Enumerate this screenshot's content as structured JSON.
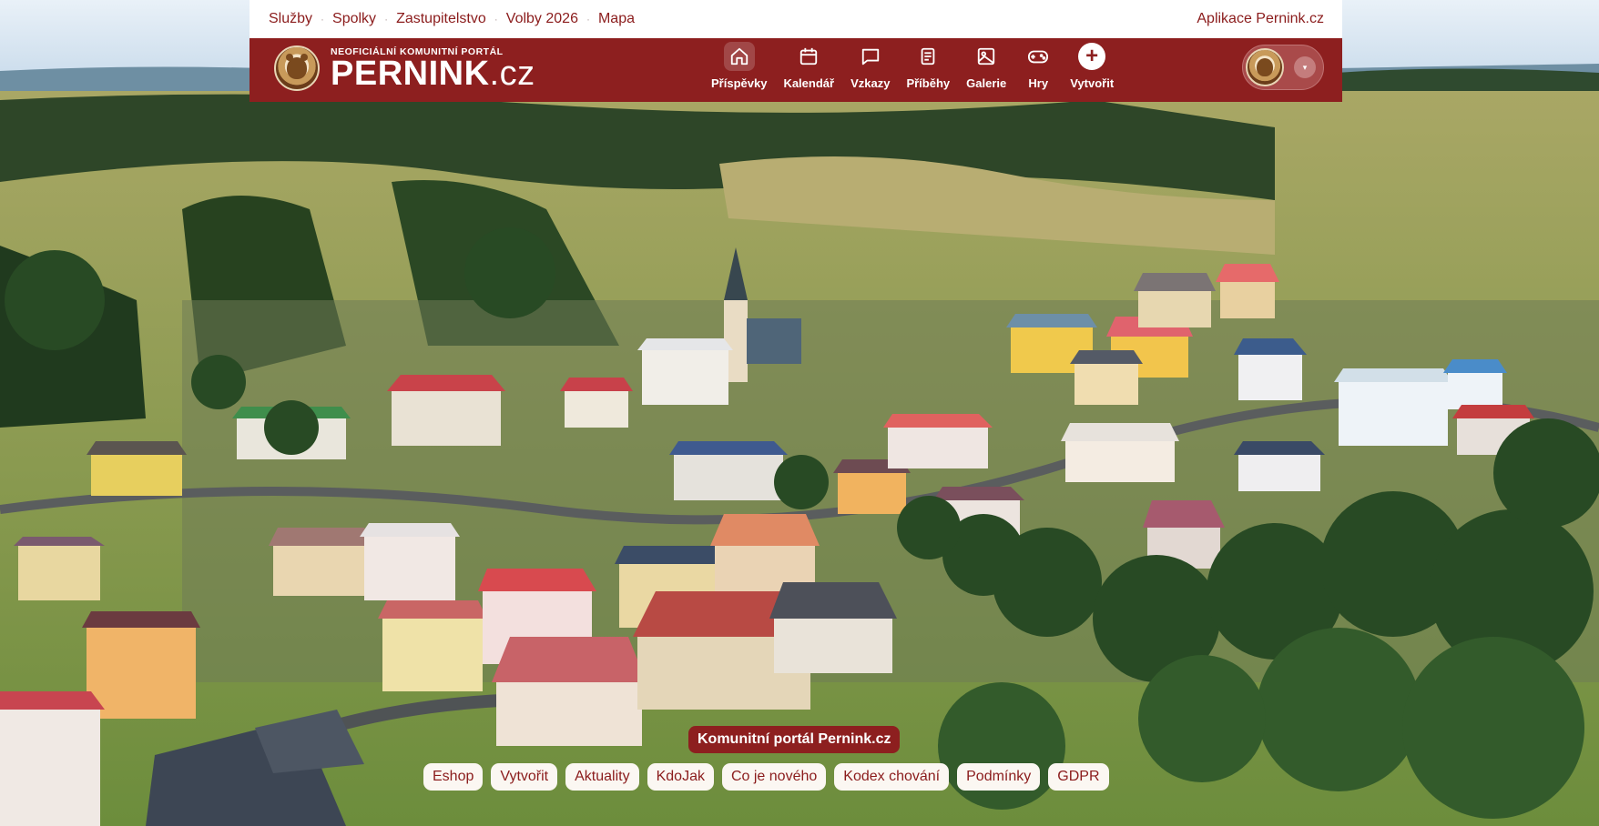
{
  "top_links": {
    "items": [
      "Služby",
      "Spolky",
      "Zastupitelstvo",
      "Volby 2026",
      "Mapa"
    ],
    "separator": "·",
    "app_link": "Aplikace Pernink.cz"
  },
  "header": {
    "logo": {
      "tagline": "NEOFICIÁLNÍ KOMUNITNÍ PORTÁL",
      "name": "PERNINK",
      "tld": ".cz"
    },
    "nav": [
      {
        "label": "Příspěvky",
        "icon": "home-icon",
        "active": true
      },
      {
        "label": "Kalendář",
        "icon": "calendar-icon"
      },
      {
        "label": "Vzkazy",
        "icon": "message-icon"
      },
      {
        "label": "Příběhy",
        "icon": "document-icon"
      },
      {
        "label": "Galerie",
        "icon": "image-icon"
      },
      {
        "label": "Hry",
        "icon": "gamepad-icon"
      },
      {
        "label": "Vytvořit",
        "icon": "plus-icon"
      }
    ],
    "user_caret": "▾"
  },
  "footer": {
    "portal_badge": "Komunitní portál Pernink.cz",
    "links": [
      "Eshop",
      "Vytvořit",
      "Aktuality",
      "KdoJak",
      "Co je nového",
      "Kodex chování",
      "Podmínky",
      "GDPR"
    ]
  },
  "colors": {
    "brand_red": "#8d1f1f",
    "link_red": "#8b1c1c",
    "pill_bg": "#fbf7f2"
  }
}
